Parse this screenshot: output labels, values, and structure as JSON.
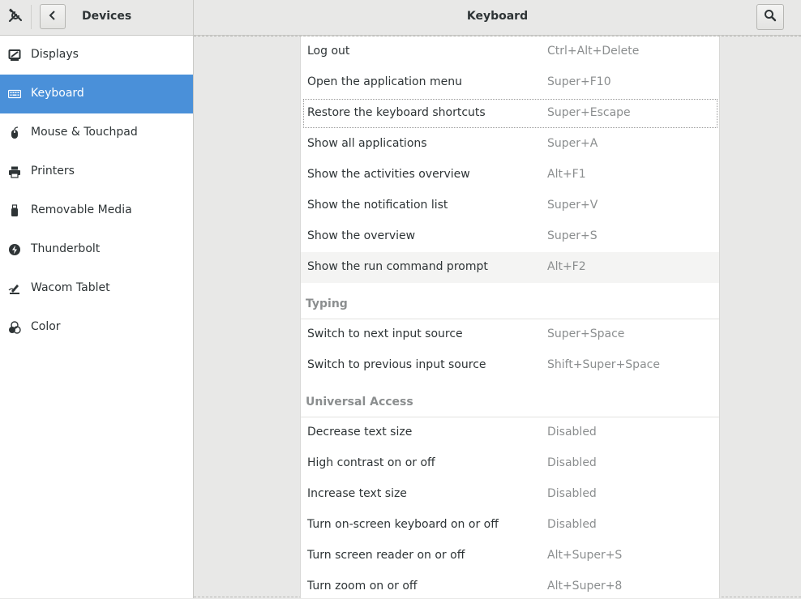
{
  "header": {
    "section_title": "Devices",
    "page_title": "Keyboard"
  },
  "sidebar": {
    "items": [
      {
        "label": "Displays",
        "icon": "display-icon"
      },
      {
        "label": "Keyboard",
        "icon": "keyboard-icon",
        "active": true
      },
      {
        "label": "Mouse & Touchpad",
        "icon": "mouse-icon"
      },
      {
        "label": "Printers",
        "icon": "printer-icon"
      },
      {
        "label": "Removable Media",
        "icon": "usb-drive-icon"
      },
      {
        "label": "Thunderbolt",
        "icon": "thunderbolt-icon"
      },
      {
        "label": "Wacom Tablet",
        "icon": "tablet-icon"
      },
      {
        "label": "Color",
        "icon": "color-icon"
      }
    ]
  },
  "shortcuts": {
    "top_rows": [
      {
        "name": "Log out",
        "accel": "Ctrl+Alt+Delete"
      },
      {
        "name": "Open the application menu",
        "accel": "Super+F10"
      },
      {
        "name": "Restore the keyboard shortcuts",
        "accel": "Super+Escape"
      },
      {
        "name": "Show all applications",
        "accel": "Super+A"
      },
      {
        "name": "Show the activities overview",
        "accel": "Alt+F1"
      },
      {
        "name": "Show the notification list",
        "accel": "Super+V"
      },
      {
        "name": "Show the overview",
        "accel": "Super+S"
      },
      {
        "name": "Show the run command prompt",
        "accel": "Alt+F2"
      }
    ],
    "typing": {
      "title": "Typing",
      "rows": [
        {
          "name": "Switch to next input source",
          "accel": "Super+Space"
        },
        {
          "name": "Switch to previous input source",
          "accel": "Shift+Super+Space"
        }
      ]
    },
    "universal_access": {
      "title": "Universal Access",
      "rows": [
        {
          "name": "Decrease text size",
          "accel": "Disabled"
        },
        {
          "name": "High contrast on or off",
          "accel": "Disabled"
        },
        {
          "name": "Increase text size",
          "accel": "Disabled"
        },
        {
          "name": "Turn on-screen keyboard on or off",
          "accel": "Disabled"
        },
        {
          "name": "Turn screen reader on or off",
          "accel": "Alt+Super+S"
        },
        {
          "name": "Turn zoom on or off",
          "accel": "Alt+Super+8"
        }
      ]
    }
  },
  "colors": {
    "accent": "#4a90d9",
    "background": "#e8e8e7",
    "dim_text": "#8b8e8f"
  }
}
